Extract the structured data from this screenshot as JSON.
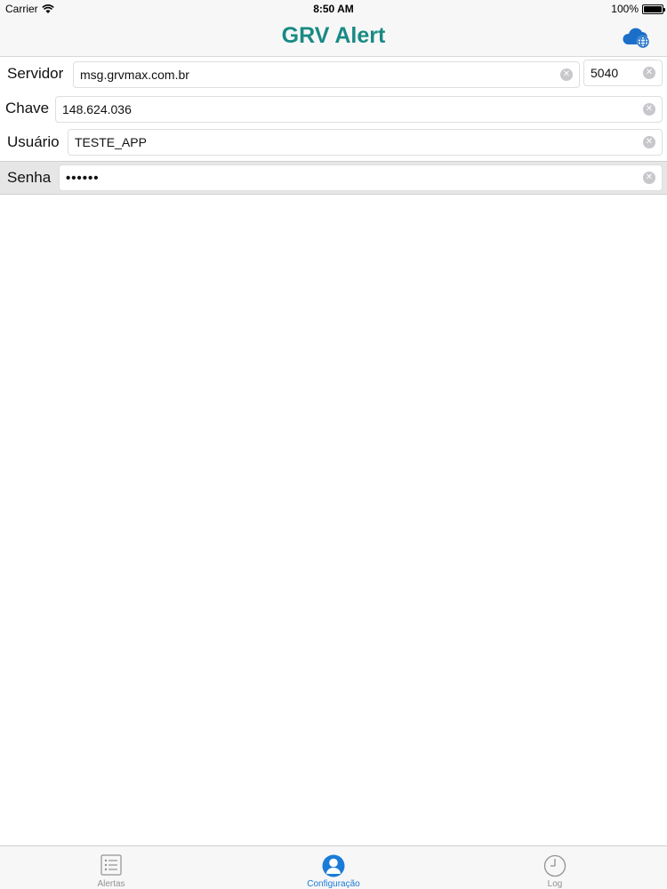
{
  "status_bar": {
    "carrier": "Carrier",
    "time": "8:50 AM",
    "battery": "100%"
  },
  "nav": {
    "title": "GRV Alert",
    "cloud_icon": "cloud-globe-icon",
    "title_color": "#198a84",
    "accent_color": "#1a7bd8"
  },
  "form": {
    "servidor": {
      "label": "Servidor",
      "value": "msg.grvmax.com.br",
      "port": "5040"
    },
    "chave": {
      "label": "Chave",
      "value": "148.624.036"
    },
    "usuario": {
      "label": "Usuário",
      "value": "TESTE_APP"
    },
    "senha": {
      "label": "Senha",
      "value": "••••••"
    }
  },
  "tab_bar": {
    "tabs": [
      {
        "label": "Alertas",
        "icon": "list-icon",
        "active": false
      },
      {
        "label": "Configuração",
        "icon": "user-icon",
        "active": true
      },
      {
        "label": "Log",
        "icon": "clock-icon",
        "active": false
      }
    ]
  }
}
